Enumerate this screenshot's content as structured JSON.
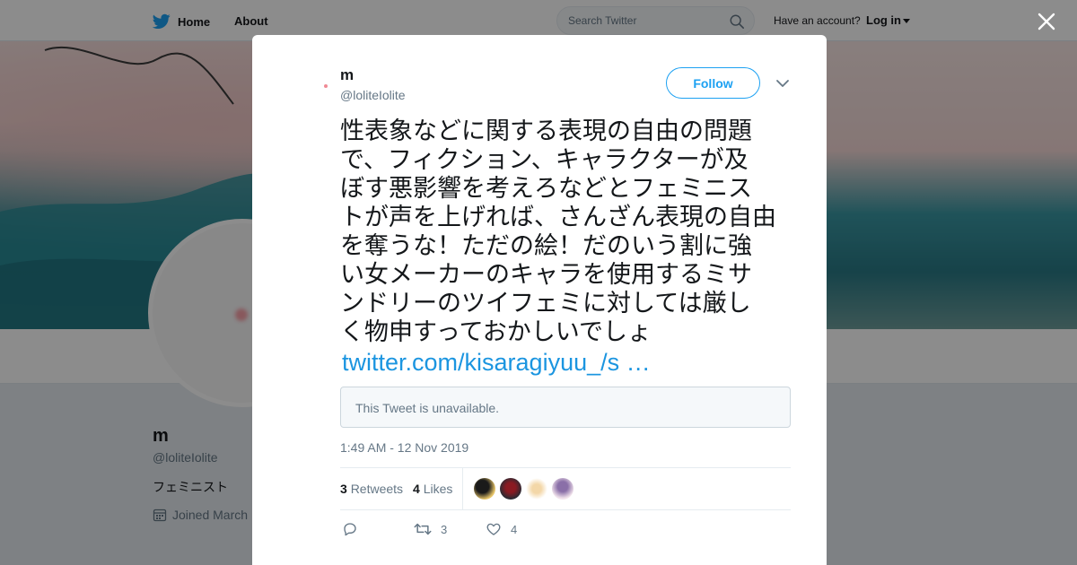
{
  "nav": {
    "home_label": "Home",
    "about_label": "About",
    "search_placeholder": "Search Twitter",
    "have_account": "Have an account?",
    "login_label": "Log in",
    "brand_color": "#1da1f2"
  },
  "profile": {
    "name": "m",
    "handle": "@loliteIolite",
    "bio": "フェミニスト",
    "joined": "Joined March"
  },
  "tweet": {
    "author_name": "m",
    "author_handle": "@loliteIolite",
    "follow_label": "Follow",
    "text_lines": [
      "性表象などに関する表現の自由の問題",
      "で、フィクション、キャラクターが及",
      "ぼす悪影響を考えろなどとフェミニス",
      "トが声を上げれば、さんざん表現の自由",
      "を奪うな！ただの絵！だのいう割に強",
      "い女メーカーのキャラを使用するミサ",
      "ンドリーのツイフェミに対しては厳し",
      "く物申すっておかしいでしょ"
    ],
    "link": "twitter.com/kisaragiyuu_/s …",
    "quote_unavailable": "This Tweet is unavailable.",
    "timestamp": "1:49 AM - 12 Nov 2019",
    "retweets_count": "3",
    "retweets_label": "Retweets",
    "likes_count": "4",
    "likes_label": "Likes",
    "action_retweet_count": "3",
    "action_like_count": "4"
  },
  "icons": {
    "logo": "twitter-bird-icon",
    "search": "search-icon",
    "close": "close-icon",
    "chevron": "chevron-down-icon",
    "reply": "reply-icon",
    "retweet": "retweet-icon",
    "like": "heart-icon",
    "calendar": "calendar-icon"
  }
}
